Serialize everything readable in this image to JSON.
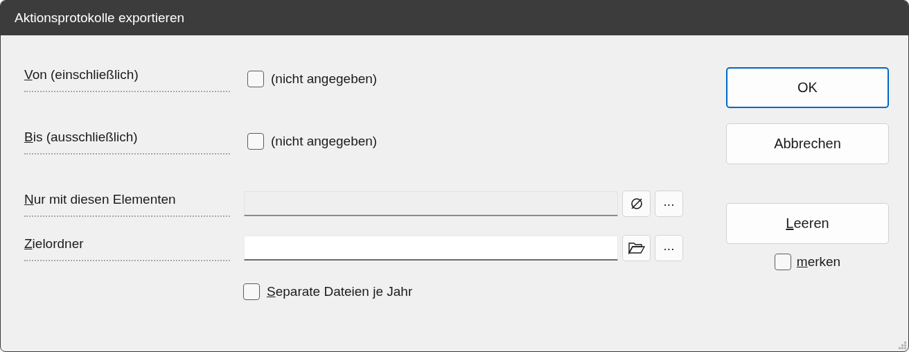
{
  "window": {
    "title": "Aktionsprotokolle exportieren"
  },
  "rows": [
    {
      "kind": "date",
      "label": "Von (einschließlich)",
      "mnemonic_underlined": true,
      "checkbox": {
        "label": "(nicht angegeben)",
        "checked": false
      }
    },
    {
      "kind": "date",
      "label": "Bis (ausschließlich)",
      "mnemonic_underlined": true,
      "checkbox": {
        "label": "(nicht angegeben)",
        "checked": false
      }
    },
    {
      "kind": "field",
      "label": "Nur mit diesen Elementen",
      "mnemonic_underlined": true,
      "field": {
        "disabled": true
      },
      "buttons": [
        {
          "kind": "clear"
        },
        {
          "kind": "browse",
          "label": "..."
        }
      ]
    },
    {
      "kind": "field",
      "label": "Zielordner",
      "mnemonic_underlined": true,
      "field": {
        "disabled": false
      },
      "buttons": [
        {
          "kind": "folder"
        },
        {
          "kind": "browse",
          "label": "..."
        }
      ]
    }
  ],
  "separate_files": {
    "label": "Separate Dateien je Jahr",
    "mnemonic_underlined": true,
    "checked": false
  },
  "dialog_buttons": [
    {
      "label": "OK",
      "default": true
    },
    {
      "label": "Abbrechen",
      "default": false
    }
  ],
  "clear_button": {
    "label": "Leeren",
    "mnemonic_underlined": true
  },
  "remember": {
    "label": "merken",
    "mnemonic_underlined": true,
    "checked": false
  }
}
